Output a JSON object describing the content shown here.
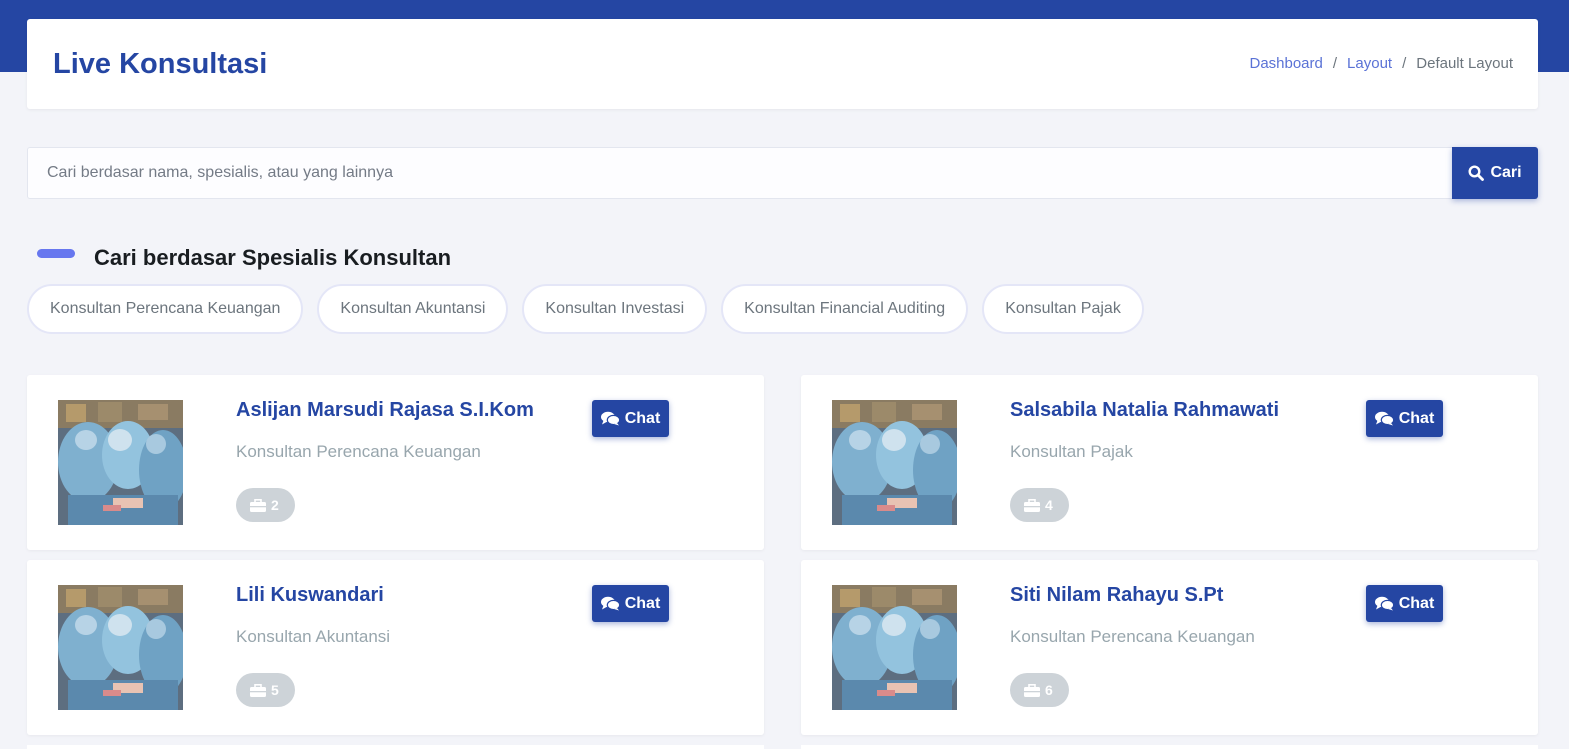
{
  "header": {
    "title": "Live Konsultasi",
    "breadcrumb": [
      "Dashboard",
      "Layout",
      "Default Layout"
    ]
  },
  "search": {
    "placeholder": "Cari berdasar nama, spesialis, atau yang lainnya",
    "value": "",
    "button_label": "Cari"
  },
  "specialists": {
    "title": "Cari berdasar Spesialis Konsultan",
    "chips": [
      "Konsultan Perencana Keuangan",
      "Konsultan Akuntansi",
      "Konsultan Investasi",
      "Konsultan Financial Auditing",
      "Konsultan Pajak"
    ]
  },
  "consultants": [
    {
      "name": "Aslijan Marsudi Rajasa S.I.Kom",
      "specialty": "Konsultan Perencana Keuangan",
      "experience": "2",
      "chat_label": "Chat"
    },
    {
      "name": "Salsabila Natalia Rahmawati",
      "specialty": "Konsultan Pajak",
      "experience": "4",
      "chat_label": "Chat"
    },
    {
      "name": "Lili Kuswandari",
      "specialty": "Konsultan Akuntansi",
      "experience": "5",
      "chat_label": "Chat"
    },
    {
      "name": "Siti Nilam Rahayu S.Pt",
      "specialty": "Konsultan Perencana Keuangan",
      "experience": "6",
      "chat_label": "Chat"
    }
  ],
  "colors": {
    "primary": "#2546a3",
    "accent": "#6777ef",
    "background": "#f3f4f9",
    "badge": "#cdd3d8"
  },
  "icons": {
    "search_button": "search-icon",
    "chat_button": "comments-icon",
    "experience_badge": "briefcase-icon"
  }
}
